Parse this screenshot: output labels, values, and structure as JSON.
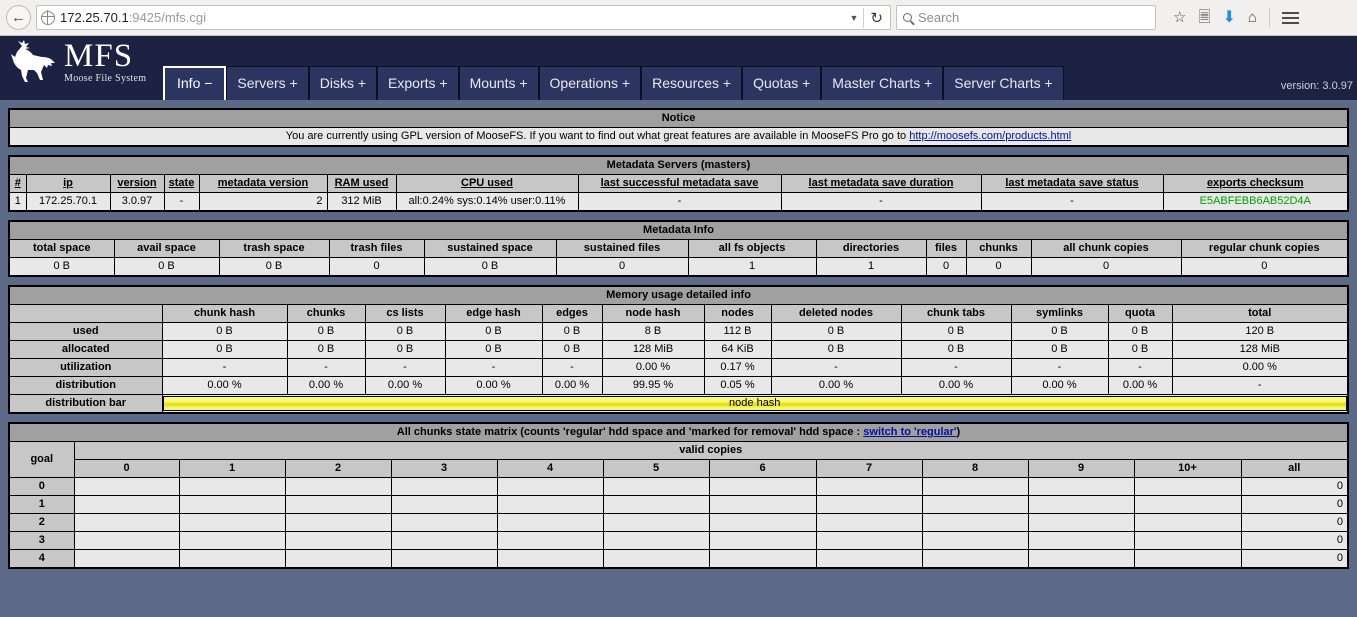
{
  "browser": {
    "back_icon": "back-arrow-icon",
    "url": "172.25.70.1",
    "url_suffix": ":9425/mfs.cgi",
    "url_full": "172.25.70.1:9425/mfs.cgi",
    "search_placeholder": "Search",
    "icons": [
      "bookmark-star-icon",
      "reader-list-icon",
      "download-icon",
      "home-icon",
      "menu-icon"
    ]
  },
  "header": {
    "logo_title": "MFS",
    "logo_subtitle": "Moose File System",
    "version": "version: 3.0.97",
    "tabs": [
      {
        "label": "Info −",
        "active": true
      },
      {
        "label": "Servers +",
        "active": false
      },
      {
        "label": "Disks +",
        "active": false
      },
      {
        "label": "Exports +",
        "active": false
      },
      {
        "label": "Mounts +",
        "active": false
      },
      {
        "label": "Operations +",
        "active": false
      },
      {
        "label": "Resources +",
        "active": false
      },
      {
        "label": "Quotas +",
        "active": false
      },
      {
        "label": "Master Charts +",
        "active": false
      },
      {
        "label": "Server Charts +",
        "active": false
      }
    ]
  },
  "notice": {
    "title": "Notice",
    "text_before": "You are currently using GPL version of MooseFS. If you want to find out what great features are available in MooseFS Pro go to ",
    "link": "http://moosefs.com/products.html"
  },
  "masters": {
    "title": "Metadata Servers (masters)",
    "headers": [
      "#",
      "ip",
      "version",
      "state",
      "metadata version",
      "RAM used",
      "CPU used",
      "last successful metadata save",
      "last metadata save duration",
      "last metadata save status",
      "exports checksum"
    ],
    "rows": [
      {
        "num": "1",
        "ip": "172.25.70.1",
        "version": "3.0.97",
        "state": "-",
        "metadata_version": "2",
        "ram_used": "312 MiB",
        "cpu_used": "all:0.24% sys:0.14% user:0.11%",
        "last_successful_save": "-",
        "last_save_duration": "-",
        "last_save_status": "-",
        "exports_checksum": "E5ABFEBB6AB52D4A"
      }
    ]
  },
  "metadata_info": {
    "title": "Metadata Info",
    "headers": [
      "total space",
      "avail space",
      "trash space",
      "trash files",
      "sustained space",
      "sustained files",
      "all fs objects",
      "directories",
      "files",
      "chunks",
      "all chunk copies",
      "regular chunk copies"
    ],
    "values": [
      "0 B",
      "0 B",
      "0 B",
      "0",
      "0 B",
      "0",
      "1",
      "1",
      "0",
      "0",
      "0",
      "0"
    ]
  },
  "memory": {
    "title": "Memory usage detailed info",
    "headers": [
      "",
      "chunk hash",
      "chunks",
      "cs lists",
      "edge hash",
      "edges",
      "node hash",
      "nodes",
      "deleted nodes",
      "chunk tabs",
      "symlinks",
      "quota",
      "total"
    ],
    "rows": [
      {
        "label": "used",
        "values": [
          "0 B",
          "0 B",
          "0 B",
          "0 B",
          "0 B",
          "8 B",
          "112 B",
          "0 B",
          "0 B",
          "0 B",
          "0 B",
          "120 B"
        ]
      },
      {
        "label": "allocated",
        "values": [
          "0 B",
          "0 B",
          "0 B",
          "0 B",
          "0 B",
          "128 MiB",
          "64 KiB",
          "0 B",
          "0 B",
          "0 B",
          "0 B",
          "128 MiB"
        ]
      },
      {
        "label": "utilization",
        "values": [
          "-",
          "-",
          "-",
          "-",
          "-",
          "0.00 %",
          "0.17 %",
          "-",
          "-",
          "-",
          "-",
          "0.00 %"
        ]
      },
      {
        "label": "distribution",
        "values": [
          "0.00 %",
          "0.00 %",
          "0.00 %",
          "0.00 %",
          "0.00 %",
          "99.95 %",
          "0.05 %",
          "0.00 %",
          "0.00 %",
          "0.00 %",
          "0.00 %",
          "-"
        ]
      }
    ],
    "bar_label": "distribution bar",
    "bar_segment_label": "node hash"
  },
  "matrix": {
    "title_before": "All chunks state matrix (counts 'regular' hdd space and 'marked for removal' hdd space : ",
    "title_link": "switch to 'regular'",
    "title_after": ")",
    "goal_label": "goal",
    "valid_copies_label": "valid copies",
    "columns": [
      "0",
      "1",
      "2",
      "3",
      "4",
      "5",
      "6",
      "7",
      "8",
      "9",
      "10+",
      "all"
    ],
    "rows": [
      {
        "goal": "0",
        "values": [
          "",
          "",
          "",
          "",
          "",
          "",
          "",
          "",
          "",
          "",
          "",
          "0"
        ]
      },
      {
        "goal": "1",
        "values": [
          "",
          "",
          "",
          "",
          "",
          "",
          "",
          "",
          "",
          "",
          "",
          "0"
        ]
      },
      {
        "goal": "2",
        "values": [
          "",
          "",
          "",
          "",
          "",
          "",
          "",
          "",
          "",
          "",
          "",
          "0"
        ]
      },
      {
        "goal": "3",
        "values": [
          "",
          "",
          "",
          "",
          "",
          "",
          "",
          "",
          "",
          "",
          "",
          "0"
        ]
      },
      {
        "goal": "4",
        "values": [
          "",
          "",
          "",
          "",
          "",
          "",
          "",
          "",
          "",
          "",
          "",
          "0"
        ]
      }
    ]
  }
}
